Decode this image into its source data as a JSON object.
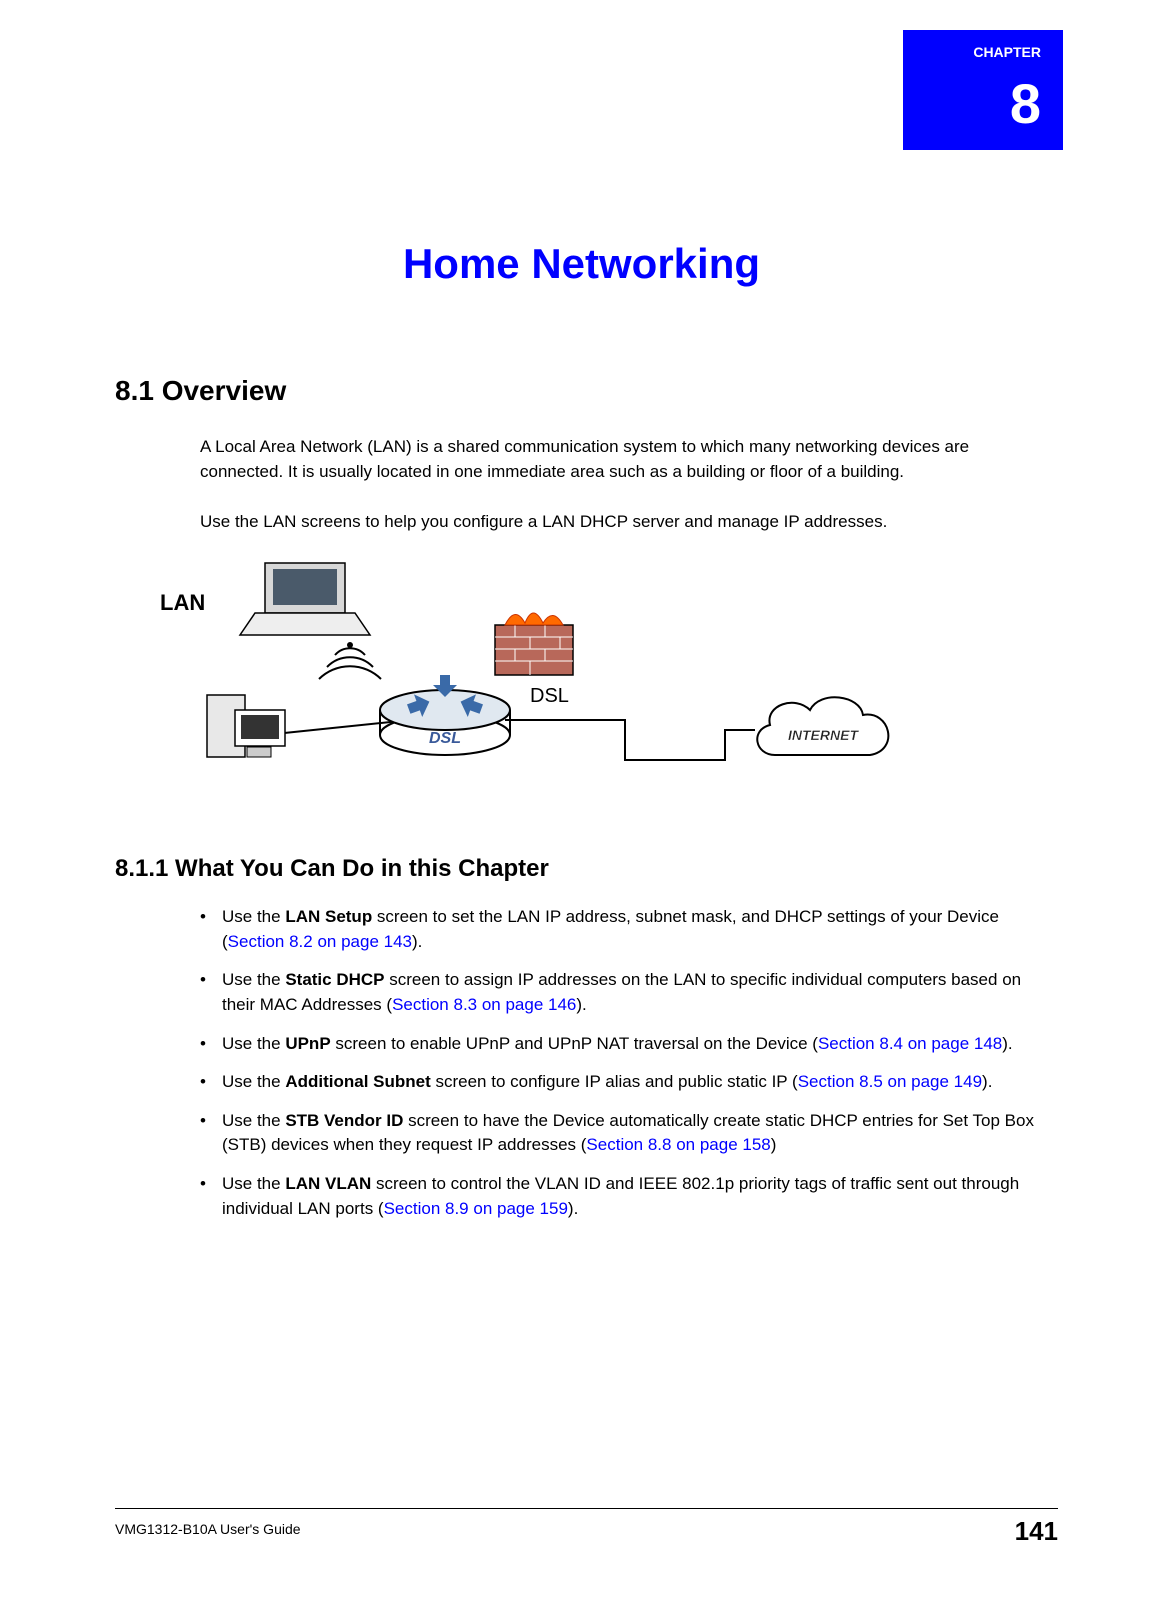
{
  "chapter": {
    "sub": "CHAPTER",
    "number": "8",
    "title": "Home Networking"
  },
  "section1": {
    "heading": "8.1  Overview",
    "para1": "A Local Area Network (LAN) is a shared communication system to which many networking devices are connected. It is usually located in one immediate area such as a building or floor of a building.",
    "para2": "Use the LAN screens to help you configure a LAN DHCP server and manage IP addresses."
  },
  "diagram": {
    "lan_label": "LAN",
    "dsl_label": "DSL",
    "internet_label": "INTERNET"
  },
  "section1_1": {
    "heading": "8.1.1  What You Can Do in this Chapter",
    "bullets": [
      {
        "pre": "Use the ",
        "bold": "LAN Setup",
        "mid": " screen to set the LAN IP address, subnet mask, and DHCP settings of your Device (",
        "link": "Section 8.2 on page 143",
        "post": ")."
      },
      {
        "pre": "Use the ",
        "bold": "Static DHCP",
        "mid": " screen to assign IP addresses on the LAN to specific individual computers based on their MAC Addresses (",
        "link": "Section 8.3 on page 146",
        "post": ")."
      },
      {
        "pre": "Use the ",
        "bold": "UPnP",
        "mid": " screen to enable UPnP and UPnP NAT traversal on the Device (",
        "link": "Section 8.4 on page 148",
        "post": ")."
      },
      {
        "pre": "Use the ",
        "bold": "Additional Subnet",
        "mid": " screen to configure IP alias and public static IP (",
        "link": "Section 8.5 on page 149",
        "post": ")."
      },
      {
        "pre": "Use the ",
        "bold": "STB Vendor ID",
        "mid": " screen to have the Device automatically create static DHCP entries for Set Top Box (STB) devices when they request IP addresses (",
        "link": "Section 8.8 on page 158",
        "post": ")"
      },
      {
        "pre": "Use the ",
        "bold": "LAN VLAN",
        "mid": " screen to control the VLAN ID and IEEE 802.1p priority tags of traffic sent out through individual LAN ports (",
        "link": "Section 8.9 on page 159",
        "post": ")."
      }
    ]
  },
  "footer": {
    "guide": "VMG1312-B10A User's Guide",
    "page": "141"
  }
}
